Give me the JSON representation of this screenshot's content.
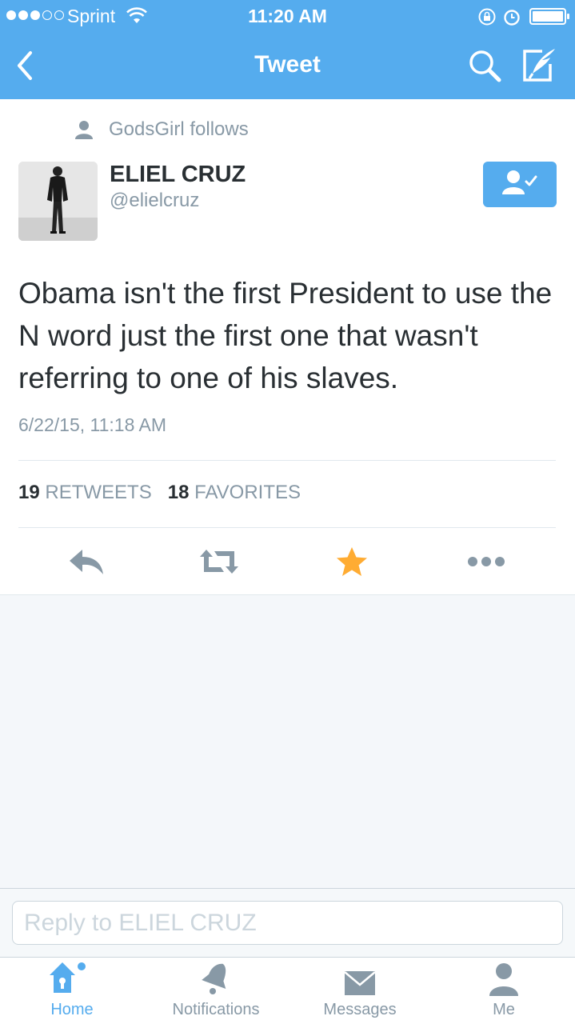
{
  "status_bar": {
    "carrier": "Sprint",
    "time": "11:20 AM"
  },
  "nav": {
    "title": "Tweet"
  },
  "tweet": {
    "social_context": "GodsGirl follows",
    "author_name": "ELIEL CRUZ",
    "author_handle": "@elielcruz",
    "text": "Obama isn't the first President to use the N word just the first one that wasn't referring to one of his slaves.",
    "timestamp": "6/22/15, 11:18 AM",
    "retweet_count": "19",
    "retweet_label": "RETWEETS",
    "favorite_count": "18",
    "favorite_label": "FAVORITES"
  },
  "reply": {
    "placeholder": "Reply to ELIEL CRUZ"
  },
  "tabs": [
    {
      "label": "Home",
      "icon": "home-icon"
    },
    {
      "label": "Notifications",
      "icon": "bell-icon"
    },
    {
      "label": "Messages",
      "icon": "envelope-icon"
    },
    {
      "label": "Me",
      "icon": "person-icon"
    }
  ],
  "colors": {
    "brand": "#55acee",
    "favorite": "#ffac33",
    "muted": "#8899a6"
  }
}
